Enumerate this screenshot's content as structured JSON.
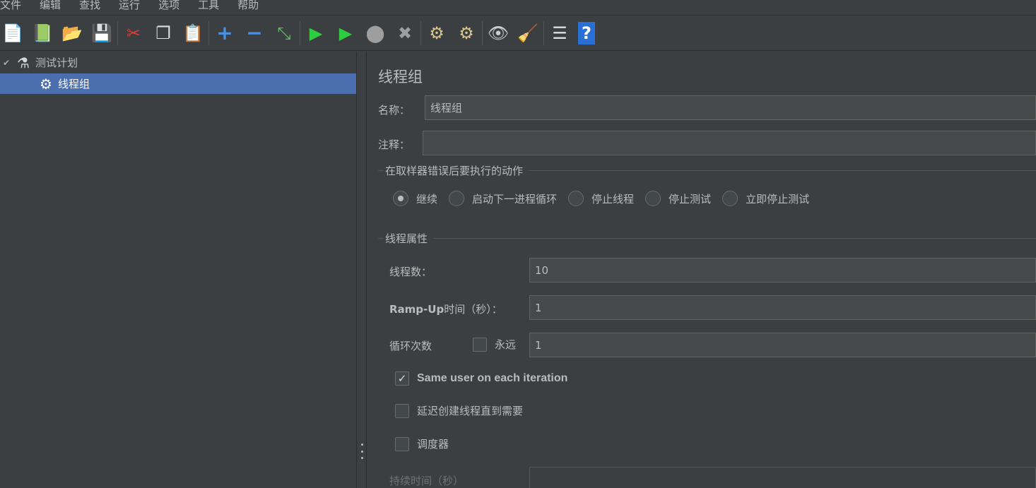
{
  "menu": [
    "文件",
    "编辑",
    "查找",
    "运行",
    "选项",
    "工具",
    "帮助"
  ],
  "toolbar": {
    "buttons": [
      {
        "name": "new-icon",
        "glyph": "📄",
        "color": "#ffffff"
      },
      {
        "name": "templates-icon",
        "glyph": "📗",
        "color": "#4caf50"
      },
      {
        "name": "open-icon",
        "glyph": "📂",
        "color": "#f0b030"
      },
      {
        "name": "save-icon",
        "glyph": "💾",
        "color": "#cccccc"
      },
      {
        "name": "cut-icon",
        "glyph": "✂",
        "color": "#e53935"
      },
      {
        "name": "copy-icon",
        "glyph": "❐",
        "color": "#dddddd"
      },
      {
        "name": "paste-icon",
        "glyph": "📋",
        "color": "#f0c060"
      },
      {
        "name": "expand-icon",
        "glyph": "+",
        "color": "#4a90e2"
      },
      {
        "name": "collapse-icon",
        "glyph": "−",
        "color": "#4a90e2"
      },
      {
        "name": "toggle-icon",
        "glyph": "⤡",
        "color": "#66bb6a"
      },
      {
        "name": "start-icon",
        "glyph": "▶",
        "color": "#2ecc40"
      },
      {
        "name": "start-no-pause-icon",
        "glyph": "▶",
        "color": "#2ecc40"
      },
      {
        "name": "stop-icon",
        "glyph": "⬤",
        "color": "#9e9e9e"
      },
      {
        "name": "shutdown-icon",
        "glyph": "✖",
        "color": "#9e9e9e"
      },
      {
        "name": "clear-icon",
        "glyph": "⚙",
        "color": "#d9c58a"
      },
      {
        "name": "clear-all-icon",
        "glyph": "⚙",
        "color": "#d9c58a"
      },
      {
        "name": "search-icon",
        "glyph": "👁",
        "color": "#cccccc"
      },
      {
        "name": "reset-search-icon",
        "glyph": "🧹",
        "color": "#f5c518"
      },
      {
        "name": "function-helper-icon",
        "glyph": "☰",
        "color": "#dddddd"
      },
      {
        "name": "help-icon",
        "glyph": "?",
        "color": "#4a90e2"
      }
    ]
  },
  "tree": {
    "root_label": "测试计划",
    "child_label": "线程组"
  },
  "panel": {
    "title": "线程组",
    "name_label": "名称：",
    "name_value": "线程组",
    "comment_label": "注释：",
    "comment_value": "",
    "error_group_title": "在取样器错误后要执行的动作",
    "error_actions": [
      "继续",
      "启动下一进程循环",
      "停止线程",
      "停止测试",
      "立即停止测试"
    ],
    "selected_action": "继续",
    "thread_group_title": "线程属性",
    "threads_label": "线程数：",
    "threads_value": "10",
    "rampup_label_bold": "Ramp-Up",
    "rampup_label_rest": "时间（秒）：",
    "rampup_value": "1",
    "loop_label": "循环次数",
    "forever_label": "永远",
    "forever_checked": false,
    "loop_value": "1",
    "same_user_label": "Same user on each iteration",
    "same_user_checked": true,
    "delay_label": "延迟创建线程直到需要",
    "delay_checked": false,
    "scheduler_label": "调度器",
    "scheduler_checked": false,
    "duration_label": "持续时间（秒）"
  }
}
